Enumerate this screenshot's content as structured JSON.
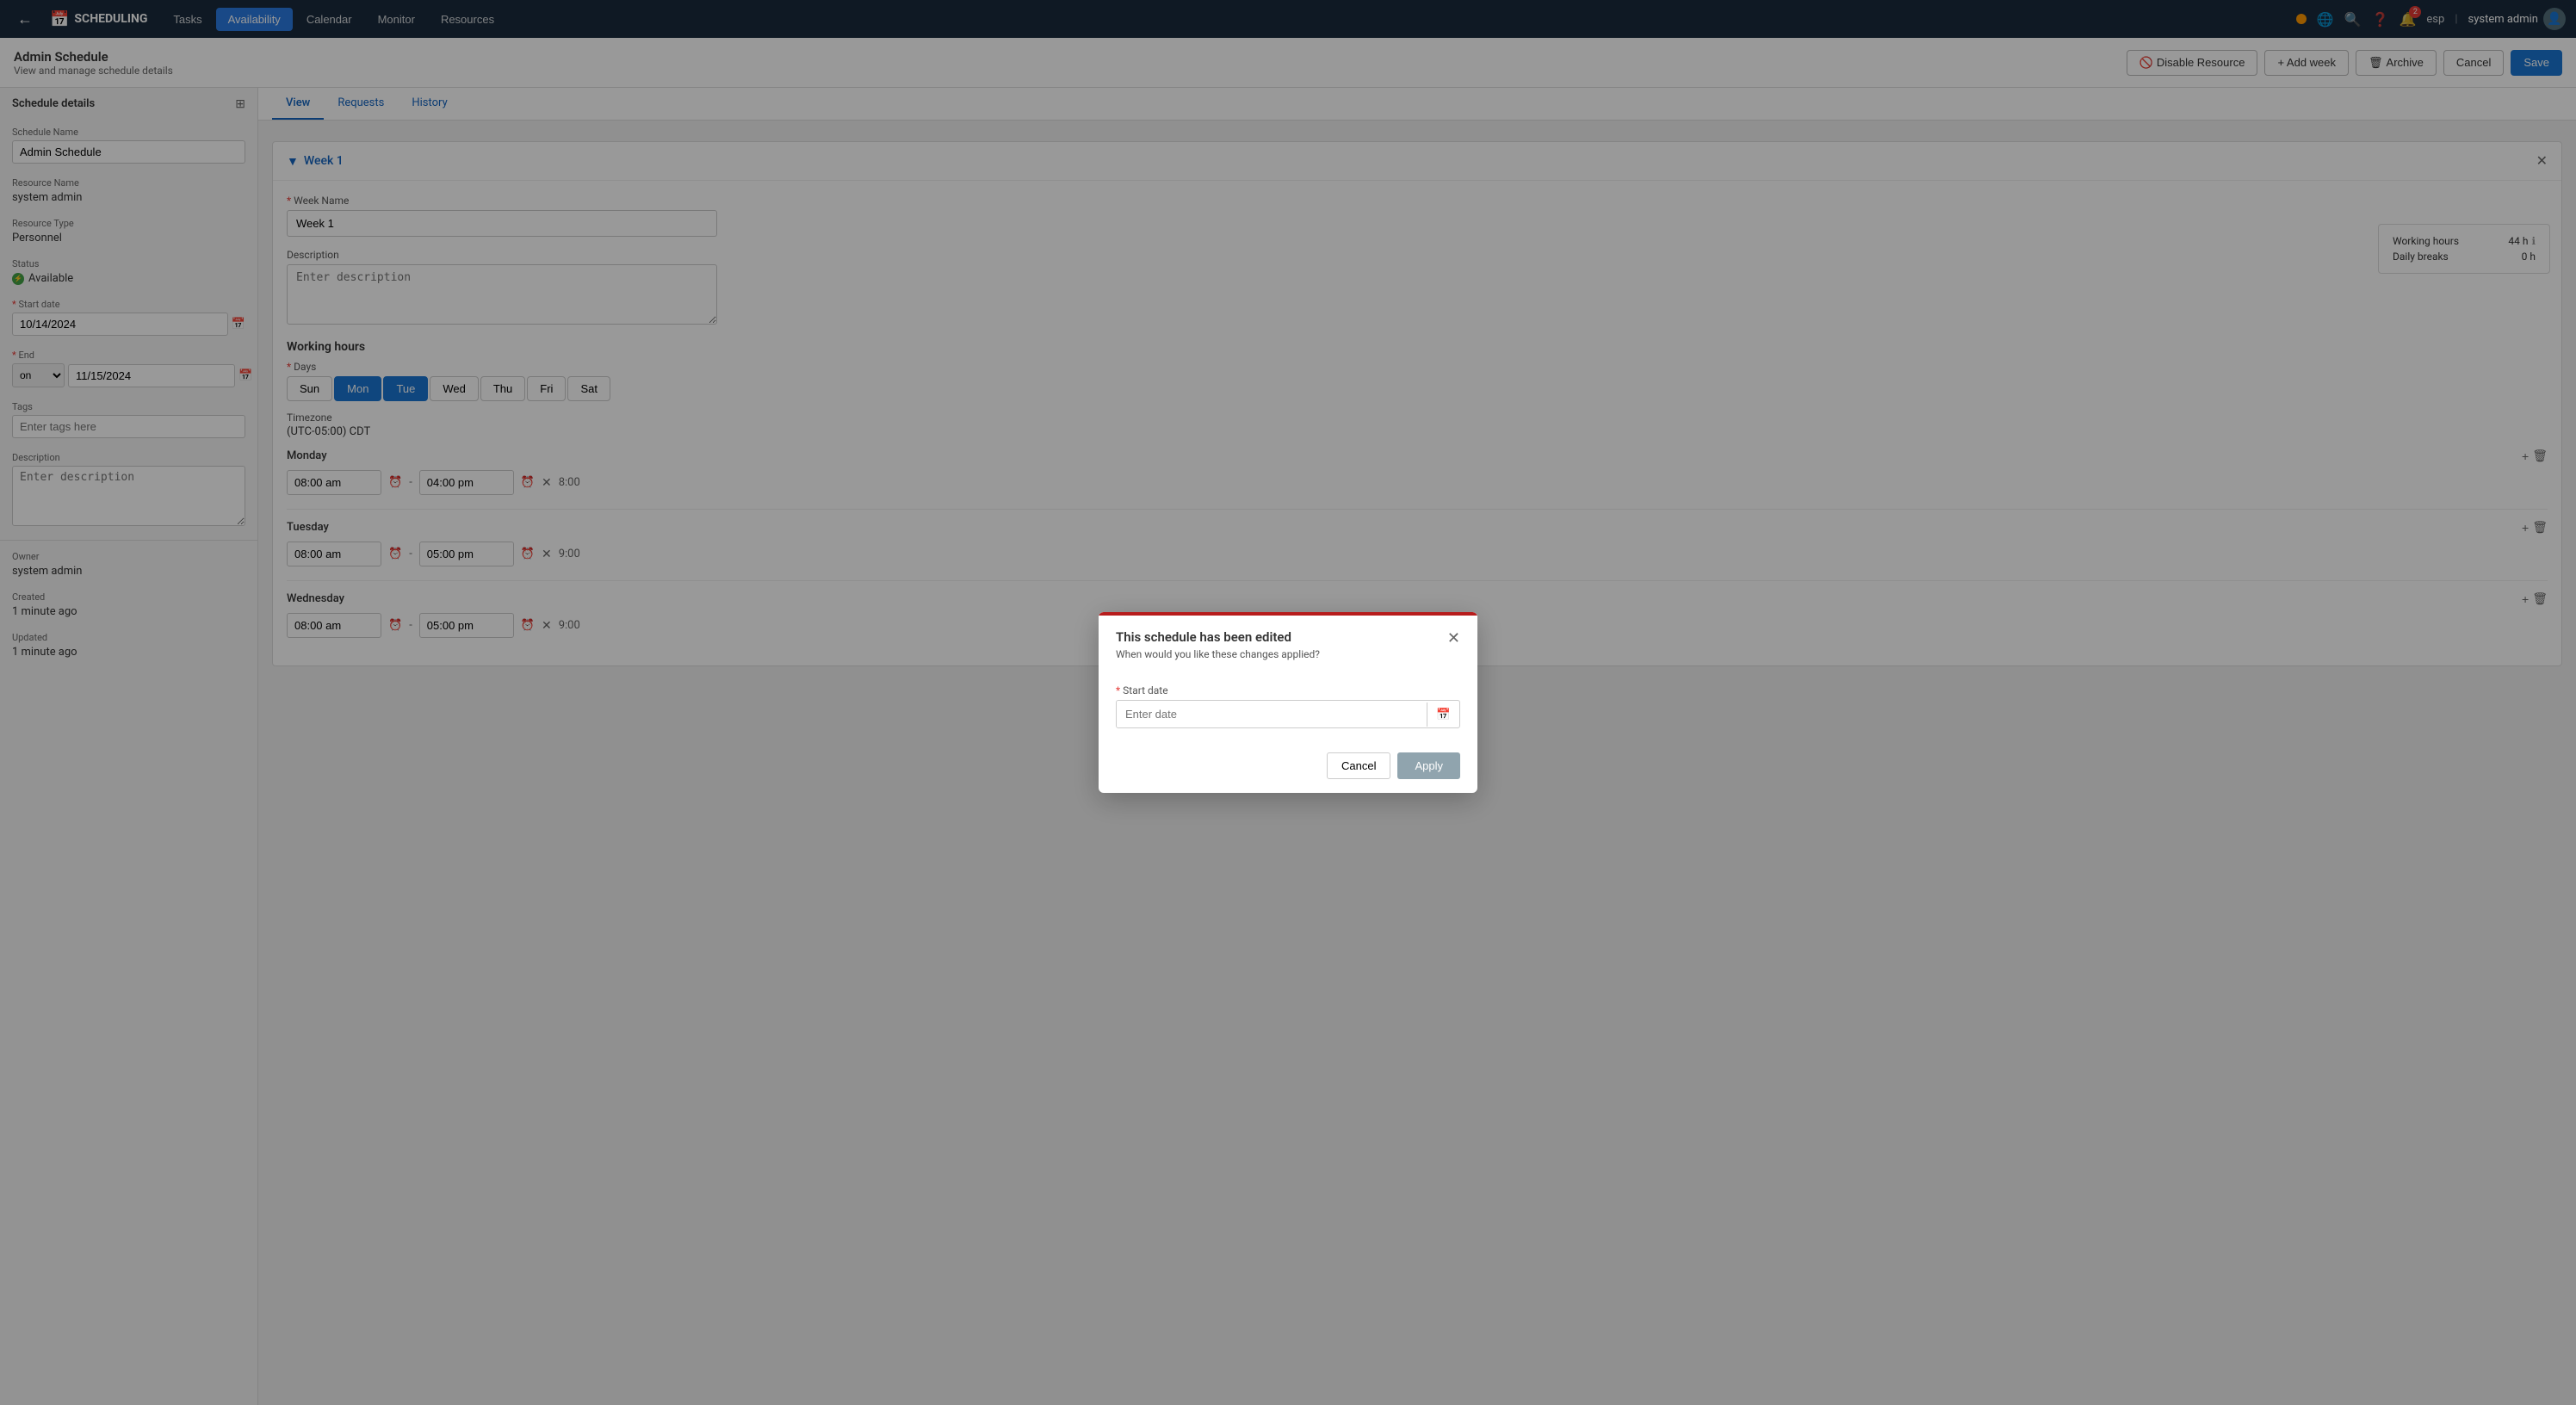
{
  "app": {
    "name": "SCHEDULING",
    "logo_icon": "📅"
  },
  "nav": {
    "tabs": [
      {
        "label": "Tasks",
        "active": false
      },
      {
        "label": "Availability",
        "active": true
      },
      {
        "label": "Calendar",
        "active": false
      },
      {
        "label": "Monitor",
        "active": false
      },
      {
        "label": "Resources",
        "active": false
      }
    ],
    "lang": "esp",
    "user": "system admin",
    "notification_count": "2"
  },
  "header": {
    "title": "Admin Schedule",
    "subtitle": "View and manage schedule details",
    "buttons": {
      "disable": "Disable Resource",
      "add_week": "+ Add week",
      "archive": "Archive",
      "cancel": "Cancel",
      "save": "Save"
    }
  },
  "sidebar": {
    "title": "Schedule details",
    "fields": {
      "schedule_name_label": "Schedule Name",
      "schedule_name_value": "Admin Schedule",
      "resource_name_label": "Resource Name",
      "resource_name_value": "system admin",
      "resource_type_label": "Resource Type",
      "resource_type_value": "Personnel",
      "status_label": "Status",
      "status_value": "Available",
      "start_date_label": "Start date",
      "start_date_value": "10/14/2024",
      "end_label": "End",
      "end_select_value": "on",
      "end_date_value": "11/15/2024",
      "tags_label": "Tags",
      "tags_placeholder": "Enter tags here",
      "description_label": "Description",
      "description_placeholder": "Enter description"
    },
    "meta": {
      "owner_label": "Owner",
      "owner_value": "system admin",
      "created_label": "Created",
      "created_value": "1 minute ago",
      "updated_label": "Updated",
      "updated_value": "1 minute ago"
    }
  },
  "content": {
    "tabs": [
      {
        "label": "View",
        "active": true
      },
      {
        "label": "Requests",
        "active": false
      },
      {
        "label": "History",
        "active": false
      }
    ],
    "week": {
      "title": "Week 1",
      "name_label": "Week Name",
      "name_value": "Week 1",
      "description_label": "Description",
      "description_placeholder": "Enter description",
      "working_hours_title": "Working hours",
      "days_label": "Days",
      "days": [
        {
          "label": "Sun",
          "active": false
        },
        {
          "label": "Mon",
          "active": true
        },
        {
          "label": "Tue",
          "active": true
        },
        {
          "label": "Wed",
          "active": false
        },
        {
          "label": "Thu",
          "active": false
        },
        {
          "label": "Fri",
          "active": false
        },
        {
          "label": "Sat",
          "active": false
        }
      ],
      "timezone_label": "Timezone",
      "timezone_value": "(UTC-05:00) CDT",
      "schedules": [
        {
          "day": "Monday",
          "start_time": "08:00 am",
          "end_time": "04:00 pm",
          "hours": "8:00"
        },
        {
          "day": "Tuesday",
          "start_time": "08:00 am",
          "end_time": "05:00 pm",
          "hours": "9:00"
        },
        {
          "day": "Wednesday",
          "start_time": "08:00 am",
          "end_time": "05:00 pm",
          "hours": "9:00"
        }
      ],
      "working_hours_panel": {
        "working_hours_label": "Working hours",
        "working_hours_value": "44 h",
        "daily_breaks_label": "Daily breaks",
        "daily_breaks_value": "0 h"
      }
    }
  },
  "modal": {
    "title": "This schedule has been edited",
    "subtitle": "When would you like these changes applied?",
    "start_date_label": "Start date",
    "start_date_placeholder": "Enter date",
    "cancel_label": "Cancel",
    "apply_label": "Apply"
  }
}
